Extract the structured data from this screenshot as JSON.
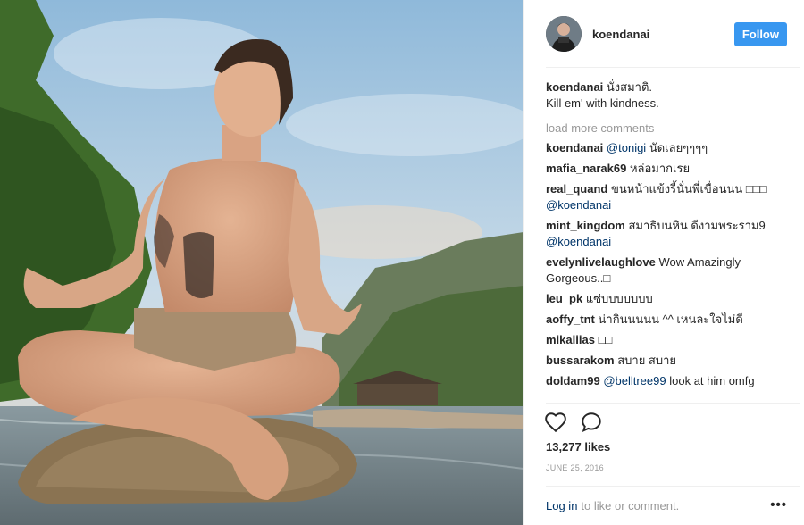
{
  "post": {
    "username": "koendanai",
    "follow_label": "Follow",
    "caption_user": "koendanai",
    "caption_line1": "นั่งสมาติ.",
    "caption_line2": "Kill em' with kindness.",
    "load_more": "load more comments",
    "comments": [
      {
        "user": "koendanai",
        "mention": "@tonigi",
        "text": "นัดเลยๆๆๆๆ"
      },
      {
        "user": "mafia_narak69",
        "text": "หล่อมากเรย"
      },
      {
        "user": "real_quand",
        "text": "ขนหน้าแข้งรี้นั่นพี่เขื่อนนน □□□",
        "mention": "@koendanai"
      },
      {
        "user": "mint_kingdom",
        "text": "สมาธิบนหิน ดีงามพระราม9",
        "mention": "@koendanai"
      },
      {
        "user": "evelynlivelaughlove",
        "text": "Wow Amazingly Gorgeous..□"
      },
      {
        "user": "leu_pk",
        "text": "แซ่บบบบบบบ"
      },
      {
        "user": "aoffy_tnt",
        "text": "น่ากินนนนน ^^ เหนละใจไม่ดี"
      },
      {
        "user": "mikaliias",
        "text": "□□"
      },
      {
        "user": "bussarakom",
        "text": "สบาย สบาย"
      },
      {
        "user": "doldam99",
        "mention": "@belltree99",
        "text": "look at him omfg"
      }
    ],
    "likes": "13,277 likes",
    "date": "JUNE 25, 2016",
    "login_link": "Log in",
    "login_rest": "to like or comment.",
    "more_label": "•••"
  },
  "icons": {
    "like": "heart-icon",
    "comment": "comment-icon",
    "more": "more-options-icon"
  },
  "colors": {
    "follow_button": "#3897f0",
    "link": "#003569",
    "muted": "#999999"
  }
}
